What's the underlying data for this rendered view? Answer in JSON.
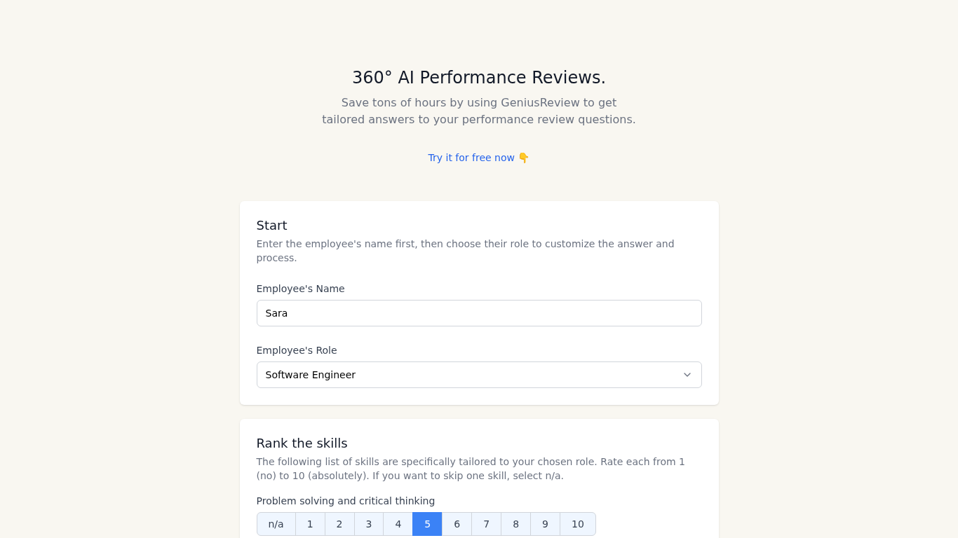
{
  "hero": {
    "title": "360° AI Performance Reviews.",
    "subtitle": "Save tons of hours by using GeniusReview to get tailored answers to your performance review questions.",
    "cta_link": "Try it for free now 👇"
  },
  "start_card": {
    "title": "Start",
    "description": "Enter the employee's name first, then choose their role to customize the answer and process.",
    "fields": [
      {
        "kind": "text",
        "label": "Employee's Name",
        "value": "Sara"
      },
      {
        "kind": "select",
        "label": "Employee's Role",
        "value": "Software Engineer"
      }
    ]
  },
  "skills_card": {
    "title": "Rank the skills",
    "description": "The following list of skills are specifically tailored to your chosen role. Rate each from 1 (no) to 10 (absolutely). If you want to skip one skill, select n/a.",
    "skills": [
      {
        "label": "Problem solving and critical thinking",
        "options": [
          {
            "label": "n/a",
            "selected": false
          },
          {
            "label": "1",
            "selected": false
          },
          {
            "label": "2",
            "selected": false
          },
          {
            "label": "3",
            "selected": false
          },
          {
            "label": "4",
            "selected": false
          },
          {
            "label": "5",
            "selected": true
          },
          {
            "label": "6",
            "selected": false
          },
          {
            "label": "7",
            "selected": false
          },
          {
            "label": "8",
            "selected": false
          },
          {
            "label": "9",
            "selected": false
          },
          {
            "label": "10",
            "selected": false
          }
        ]
      }
    ]
  }
}
